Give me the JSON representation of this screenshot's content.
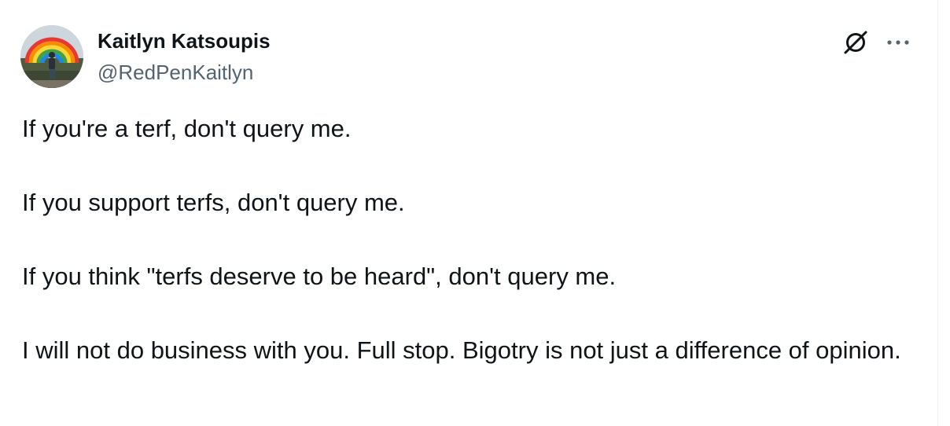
{
  "author": {
    "display_name": "Kaitlyn Katsoupis",
    "handle": "@RedPenKaitlyn",
    "avatar_icon": "avatar"
  },
  "actions": {
    "grok_icon": "grok-icon",
    "more_icon": "more-options-icon"
  },
  "tweet": {
    "paragraphs": [
      "If you're a terf, don't query me.",
      "If you support terfs, don't query me.",
      "If you think \"terfs deserve to be heard\", don't query me.",
      "I will not do business with you. Full stop. Bigotry is not just a difference of opinion."
    ]
  },
  "colors": {
    "text_primary": "#0f1419",
    "text_secondary": "#536471",
    "border": "#eff3f4"
  }
}
